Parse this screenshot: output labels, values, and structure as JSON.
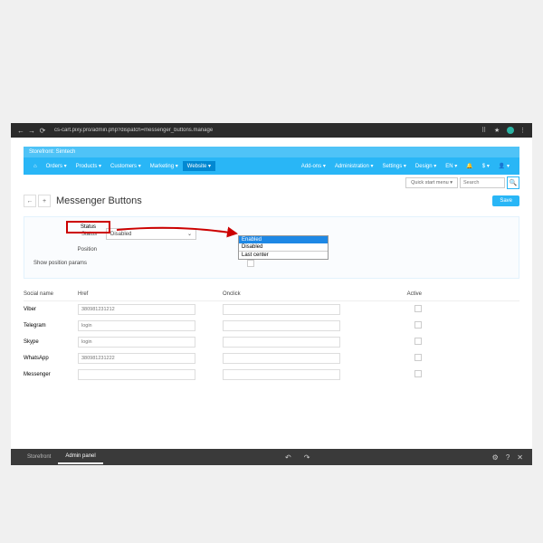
{
  "browser": {
    "url": "cs-cart.pixy.pro/admin.php?dispatch=messenger_buttons.manage"
  },
  "storefront": {
    "label": "Storefront: Simtech"
  },
  "topnav": {
    "left": [
      "Orders",
      "Products",
      "Customers",
      "Marketing",
      "Website"
    ],
    "right": [
      "Add-ons",
      "Administration",
      "Settings",
      "Design",
      "EN",
      "$"
    ],
    "quick": "Quick start menu",
    "search_placeholder": "Search"
  },
  "page": {
    "title": "Messenger Buttons",
    "save": "Save"
  },
  "settings": {
    "status_label": "Status",
    "status_value": "Disabled",
    "options": [
      "Enabled",
      "Disabled",
      "Last center"
    ],
    "position_label": "Position",
    "show_params_label": "Show position params"
  },
  "table": {
    "headers": {
      "name": "Social name",
      "href": "Href",
      "onclick": "Onclick",
      "active": "Active"
    },
    "rows": [
      {
        "name": "Viber",
        "href_ph": "380981231212"
      },
      {
        "name": "Telegram",
        "href_ph": "login"
      },
      {
        "name": "Skype",
        "href_ph": "login"
      },
      {
        "name": "WhatsApp",
        "href_ph": "380981231222"
      },
      {
        "name": "Messenger",
        "href_ph": ""
      }
    ]
  },
  "bottom": {
    "tab1": "Storefront",
    "tab2": "Admin panel"
  }
}
